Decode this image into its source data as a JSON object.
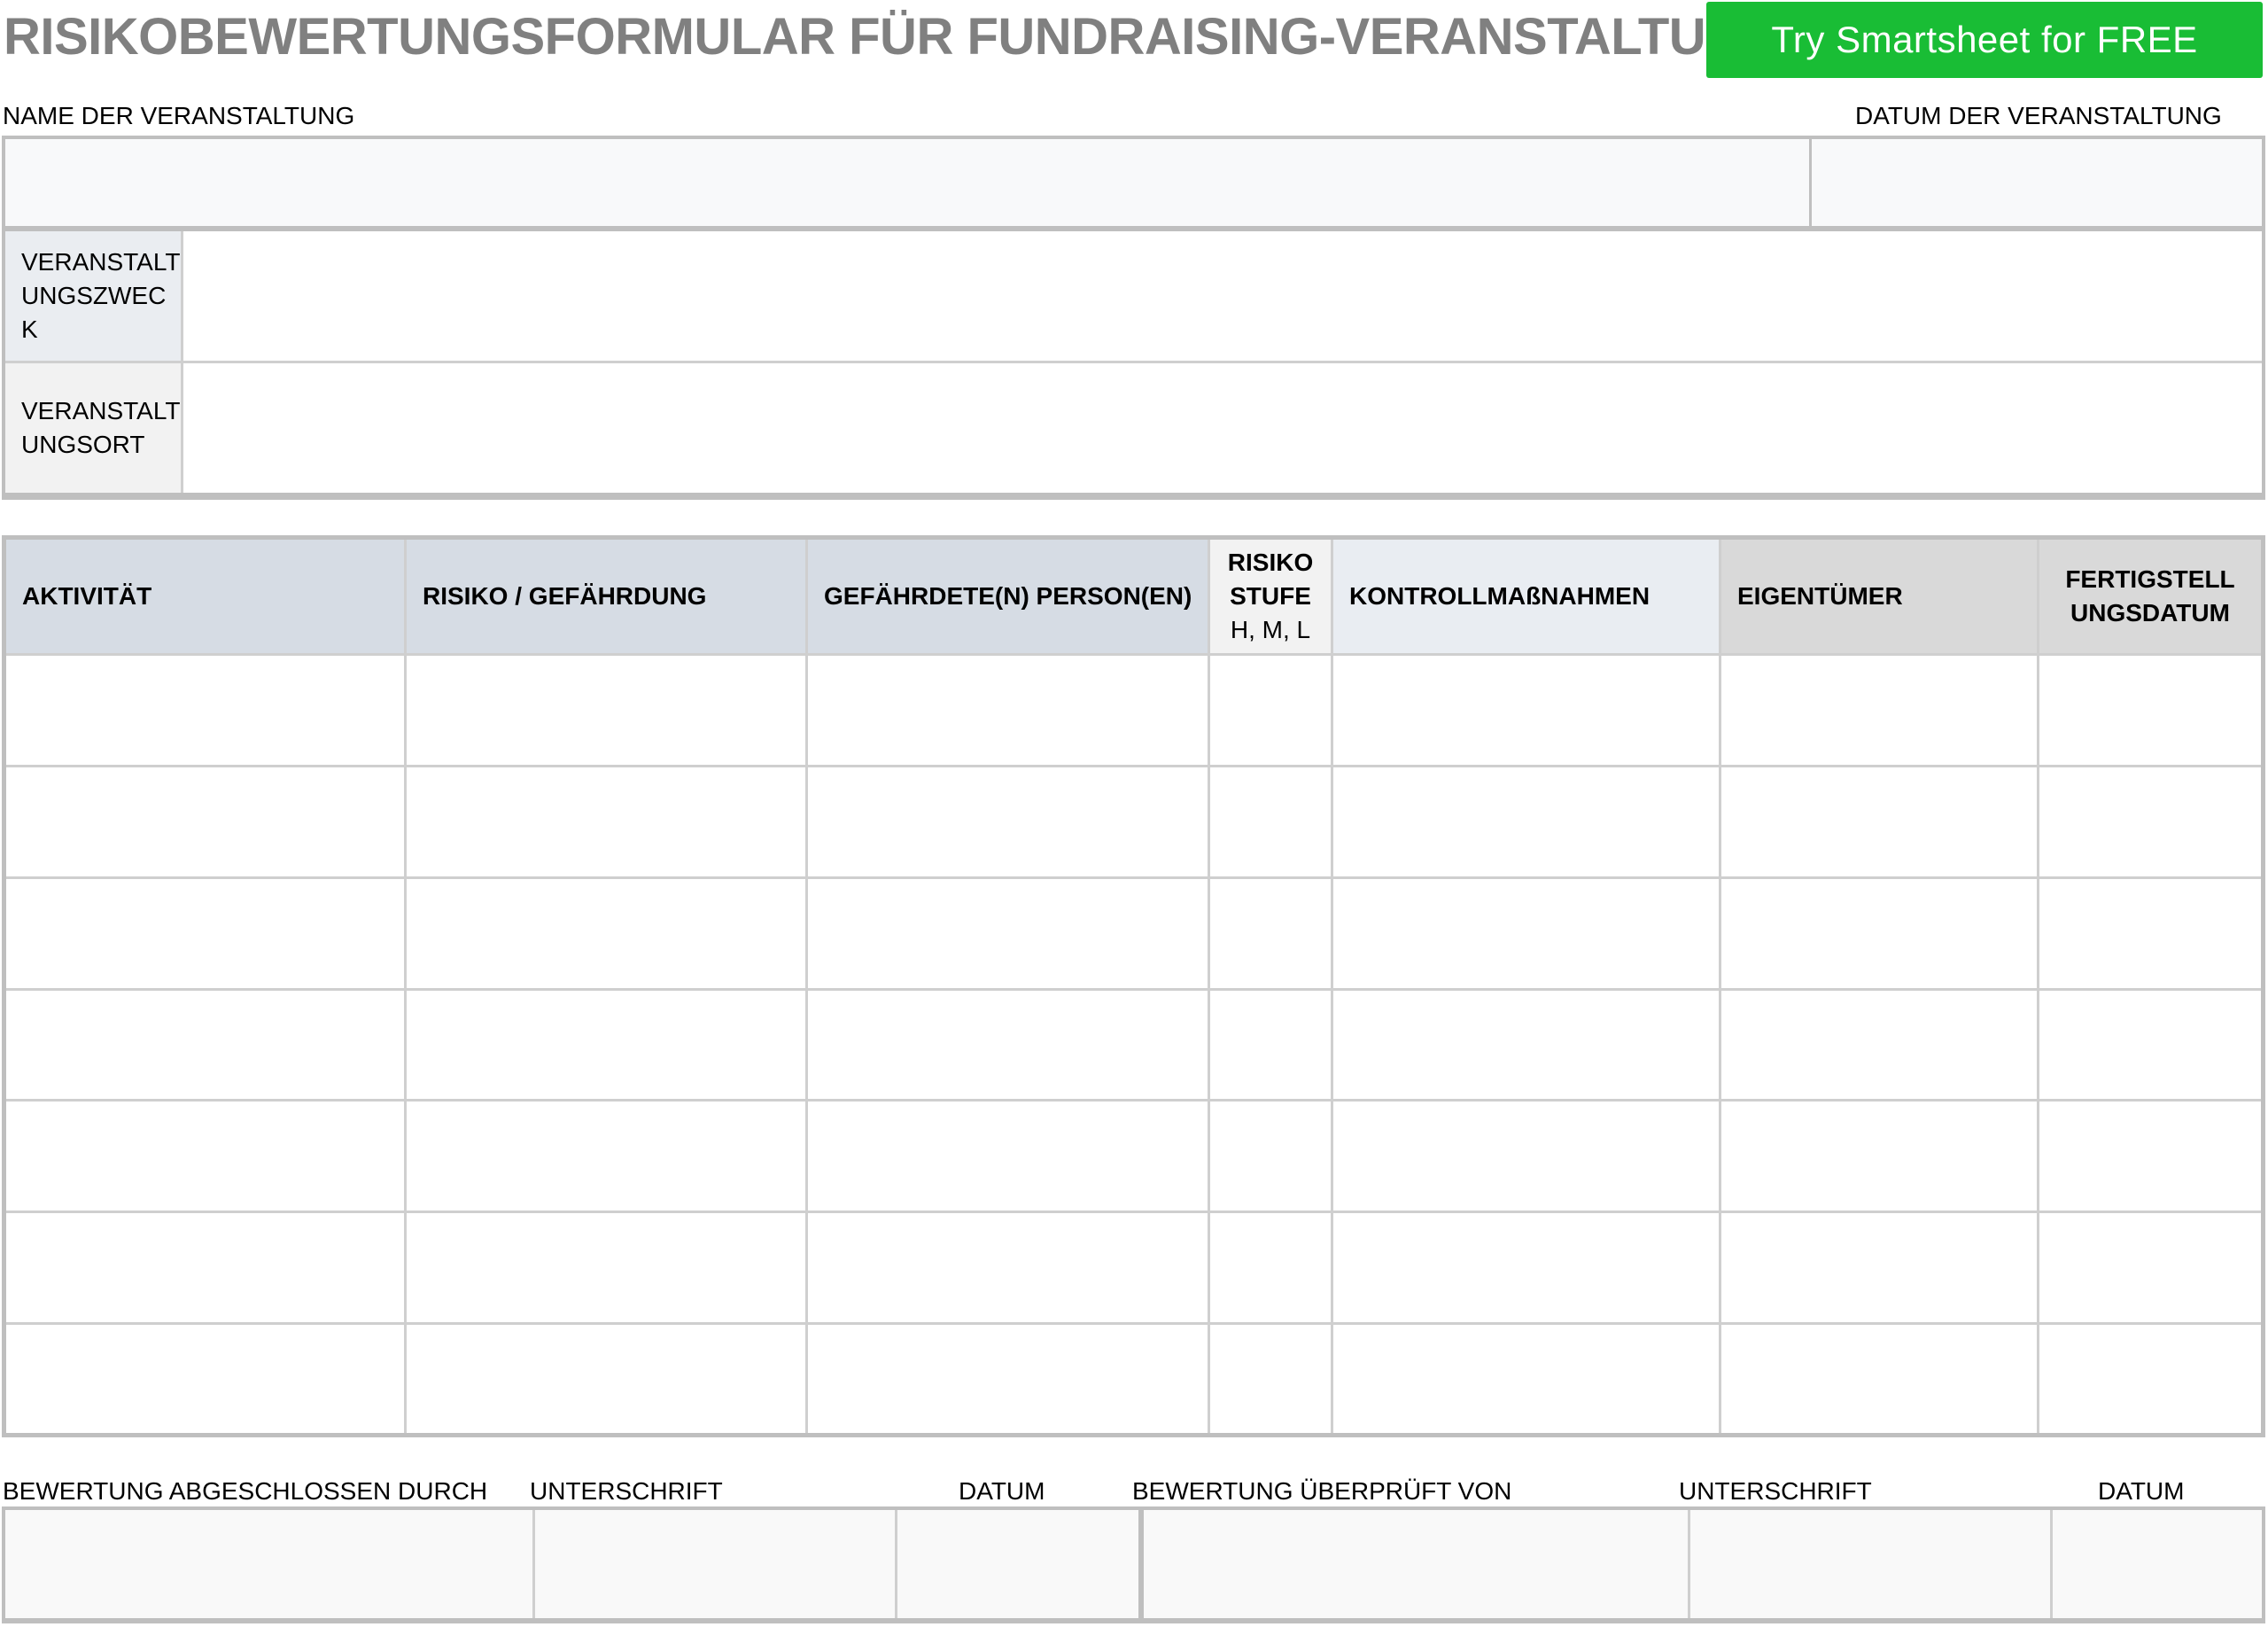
{
  "title": "RISIKOBEWERTUNGSFORMULAR FÜR FUNDRAISING-VERANSTALTUNGEN",
  "cta_button": "Try Smartsheet for FREE",
  "header_labels": {
    "event_name": "NAME DER VERANSTALTUNG",
    "event_date": "DATUM DER VERANSTALTUNG"
  },
  "info_rows": [
    {
      "label": "VERANSTALTUNGSZWECK",
      "value": ""
    },
    {
      "label": "VERANSTALTUNGSORT",
      "value": ""
    }
  ],
  "table": {
    "columns": [
      {
        "label": "AKTIVITÄT",
        "sub": ""
      },
      {
        "label": "RISIKO / GEFÄHRDUNG",
        "sub": ""
      },
      {
        "label": "GEFÄHRDETE(N) PERSON(EN)",
        "sub": ""
      },
      {
        "label": "RISIKO STUFE",
        "sub": "H, M, L"
      },
      {
        "label": "KONTROLLMAßNAHMEN",
        "sub": ""
      },
      {
        "label": "EIGENTÜMER",
        "sub": ""
      },
      {
        "label": "FERTIGSTELLUNGSDATUM",
        "sub": ""
      }
    ],
    "rows": [
      [
        "",
        "",
        "",
        "",
        "",
        "",
        ""
      ],
      [
        "",
        "",
        "",
        "",
        "",
        "",
        ""
      ],
      [
        "",
        "",
        "",
        "",
        "",
        "",
        ""
      ],
      [
        "",
        "",
        "",
        "",
        "",
        "",
        ""
      ],
      [
        "",
        "",
        "",
        "",
        "",
        "",
        ""
      ],
      [
        "",
        "",
        "",
        "",
        "",
        "",
        ""
      ],
      [
        "",
        "",
        "",
        "",
        "",
        "",
        ""
      ]
    ]
  },
  "footer_labels": {
    "completed_by": "BEWERTUNG ABGESCHLOSSEN DURCH",
    "signature1": "UNTERSCHRIFT",
    "date1": "DATUM",
    "reviewed_by": "BEWERTUNG ÜBERPRÜFT VON",
    "signature2": "UNTERSCHRIFT",
    "date2": "DATUM"
  }
}
